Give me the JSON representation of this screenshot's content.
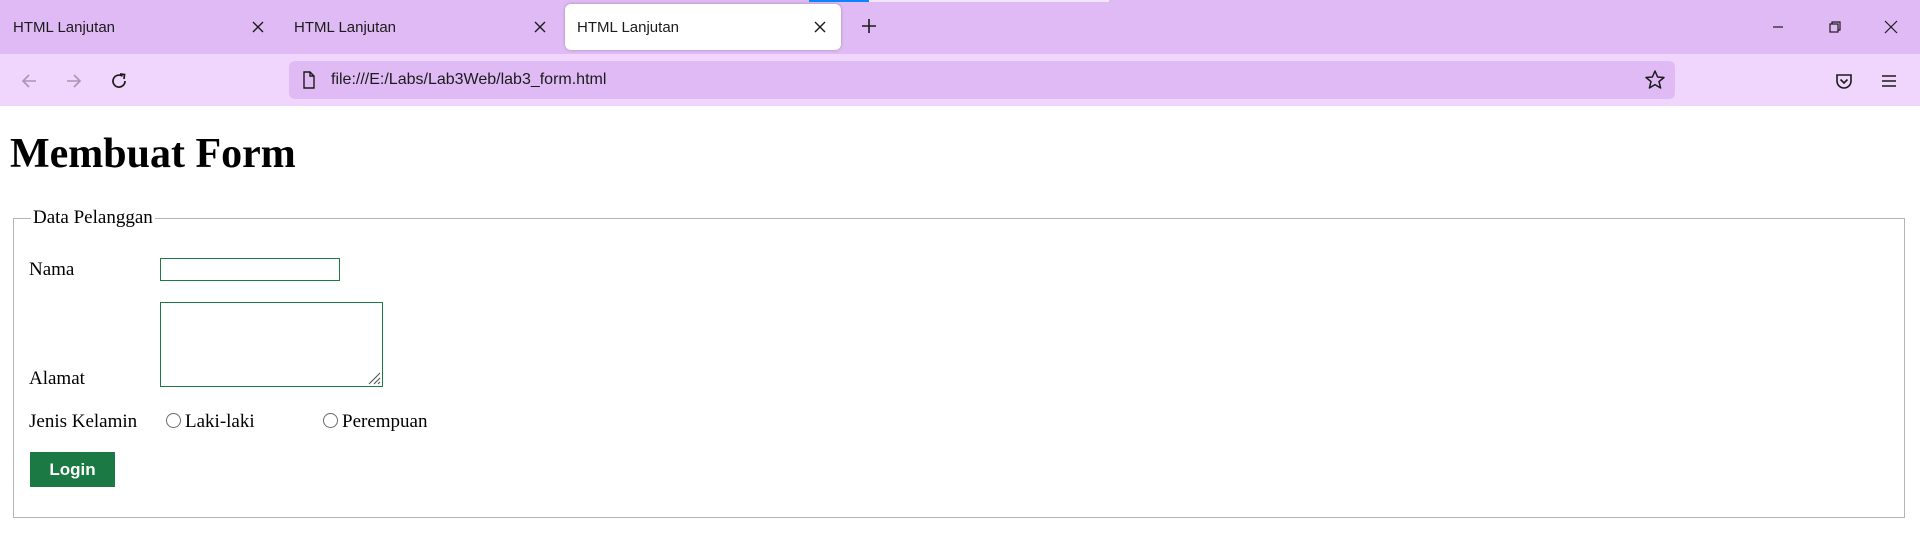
{
  "browser": {
    "tabs": [
      {
        "title": "HTML Lanjutan",
        "active": false
      },
      {
        "title": "HTML Lanjutan",
        "active": false
      },
      {
        "title": "HTML Lanjutan",
        "active": true
      }
    ],
    "address": "file:///E:/Labs/Lab3Web/lab3_form.html",
    "colors": {
      "tabstrip": "#e0baf5",
      "toolbar": "#f0d5fc",
      "active_tab": "#ffffff"
    }
  },
  "page": {
    "heading": "Membuat Form",
    "form": {
      "legend": "Data Pelanggan",
      "nama_label": "Nama",
      "nama_value": "",
      "alamat_label": "Alamat",
      "alamat_value": "",
      "gender_label": "Jenis Kelamin",
      "gender_options": [
        "Laki-laki",
        "Perempuan"
      ],
      "submit_label": "Login"
    },
    "colors": {
      "accent": "#1b7a44"
    }
  }
}
